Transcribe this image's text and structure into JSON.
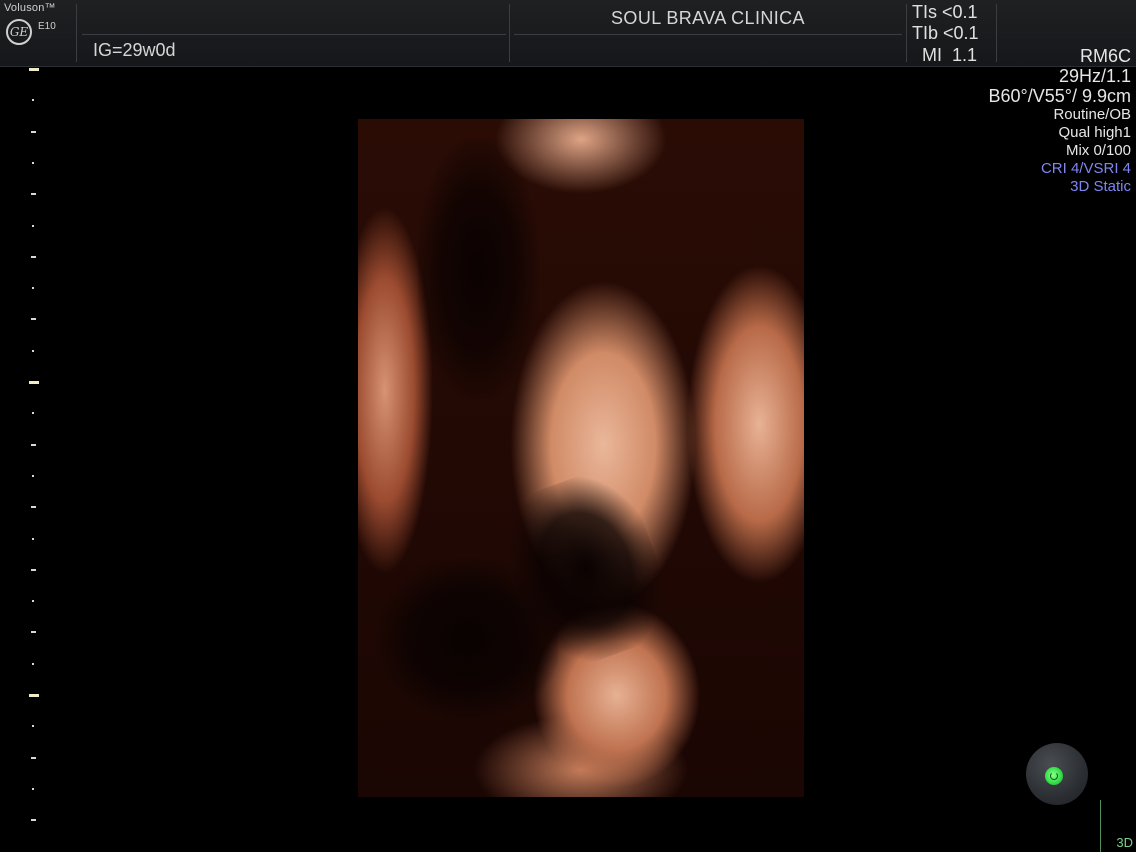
{
  "header": {
    "brand": "Voluson™",
    "logo_text": "GE",
    "model": "E10",
    "gestational_age": "IG=29w0d",
    "clinic_name": "SOUL BRAVA CLINICA",
    "indices": {
      "tis": "TIs <0.1",
      "tib": "TIb <0.1",
      "mi": "MI  1.1"
    }
  },
  "params": {
    "probe": "RM6C",
    "frame_rate": "29Hz/1.1",
    "angles_depth": "B60°/V55°/ 9.9cm",
    "preset": "Routine/OB",
    "quality": "Qual high1",
    "mix": "Mix 0/100",
    "cri_vsri": "CRI 4/VSRI 4",
    "mode": "3D Static"
  },
  "footer": {
    "mode_label": "3D"
  },
  "colors": {
    "background": "#000000",
    "header": "#1a1c1f",
    "accent_blue": "#7f86f2",
    "trackball_green": "#36e04a",
    "mode_green": "#7fd08a"
  },
  "icons": {
    "logo": "ge-logo-icon",
    "trackball": "trackball-indicator-icon"
  }
}
